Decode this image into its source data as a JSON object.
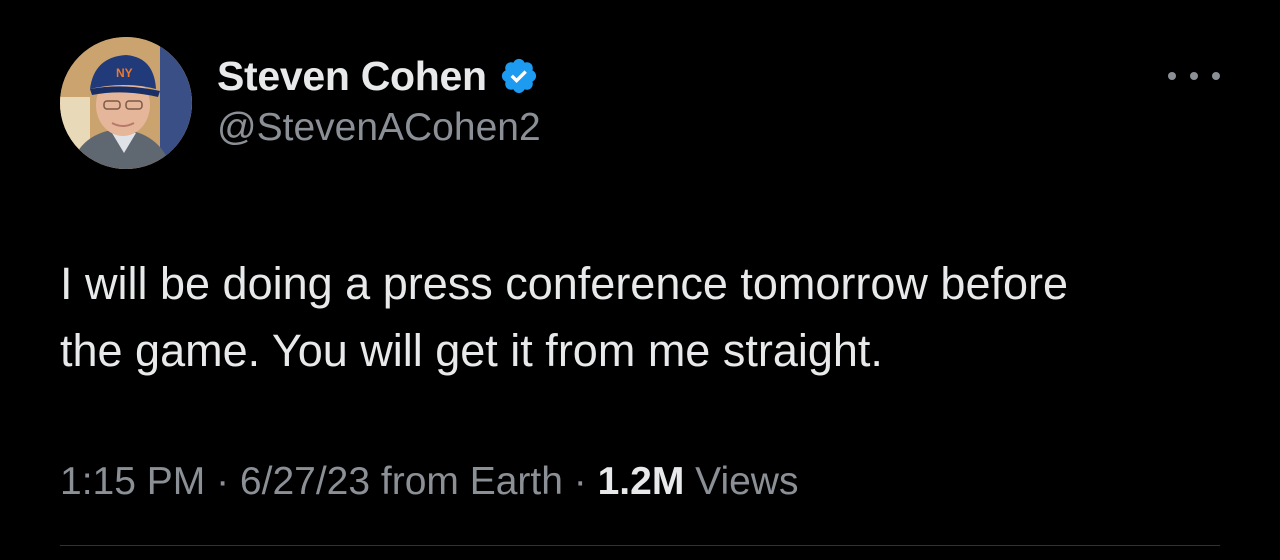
{
  "author": {
    "display_name": "Steven Cohen",
    "handle": "@StevenACohen2",
    "verified": true,
    "verified_color": "#1d9bf0"
  },
  "tweet": {
    "text_line_1": "I will be doing a press conference tomorrow before",
    "text_line_2": "the game. You will get it from me straight."
  },
  "meta": {
    "time": "1:15 PM",
    "separator_1": " · ",
    "date": "6/27/23",
    "source": " from Earth",
    "separator_2": " · ",
    "views_count": "1.2M",
    "views_label": " Views"
  },
  "icons": {
    "more": "more-horizontal-icon",
    "verified": "verified-badge-icon"
  },
  "colors": {
    "background": "#000000",
    "primary_text": "#e7e9ea",
    "secondary_text": "#8b9096",
    "divider": "#2f3336"
  }
}
